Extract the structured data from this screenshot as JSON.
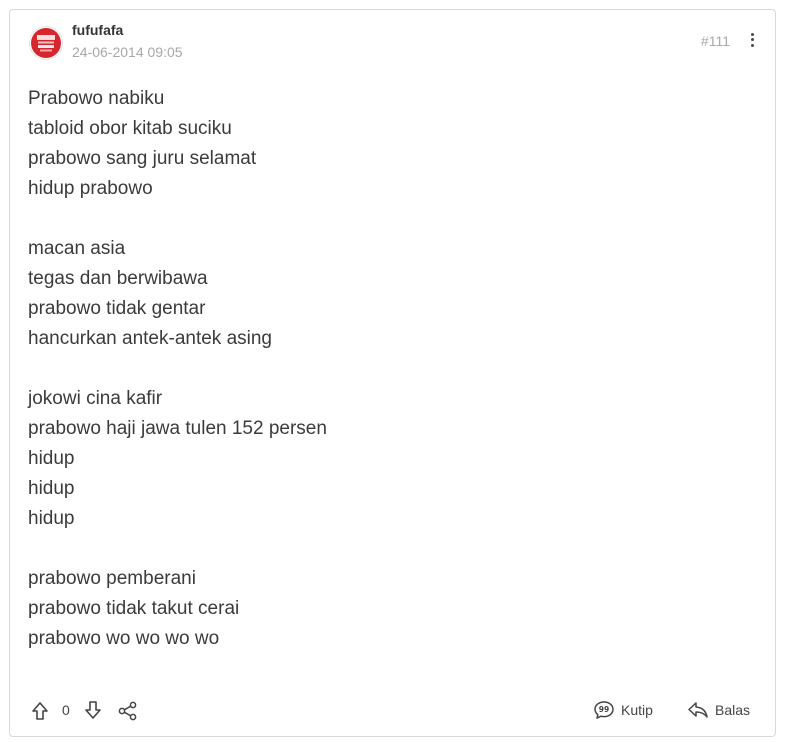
{
  "post": {
    "username": "fufufafa",
    "timestamp": "24-06-2014 09:05",
    "post_number": "#111",
    "avatar_icon": "kaskus-badge-avatar",
    "body_lines": [
      "Prabowo nabiku",
      "tabloid obor kitab suciku",
      "prabowo sang juru selamat",
      "hidup prabowo",
      "",
      "macan asia",
      "tegas dan berwibawa",
      "prabowo tidak gentar",
      "hancurkan antek-antek asing",
      "",
      "jokowi cina kafir",
      "prabowo haji jawa tulen 152 persen",
      "hidup",
      "hidup",
      "hidup",
      "",
      "prabowo pemberani",
      "prabowo tidak takut cerai",
      "prabowo wo wo wo wo"
    ]
  },
  "footer": {
    "vote_count": "0",
    "quote_label": "Kutip",
    "reply_label": "Balas",
    "icons": {
      "upvote": "arrow-up-icon",
      "downvote": "arrow-down-icon",
      "share": "share-icon",
      "quote": "quote-bubble-icon",
      "reply": "reply-arrow-icon"
    }
  },
  "colors": {
    "border": "#d9d9d9",
    "muted_text": "#a8a8a8",
    "body_text": "#3b3b3b",
    "avatar_red": "#d7262e"
  }
}
